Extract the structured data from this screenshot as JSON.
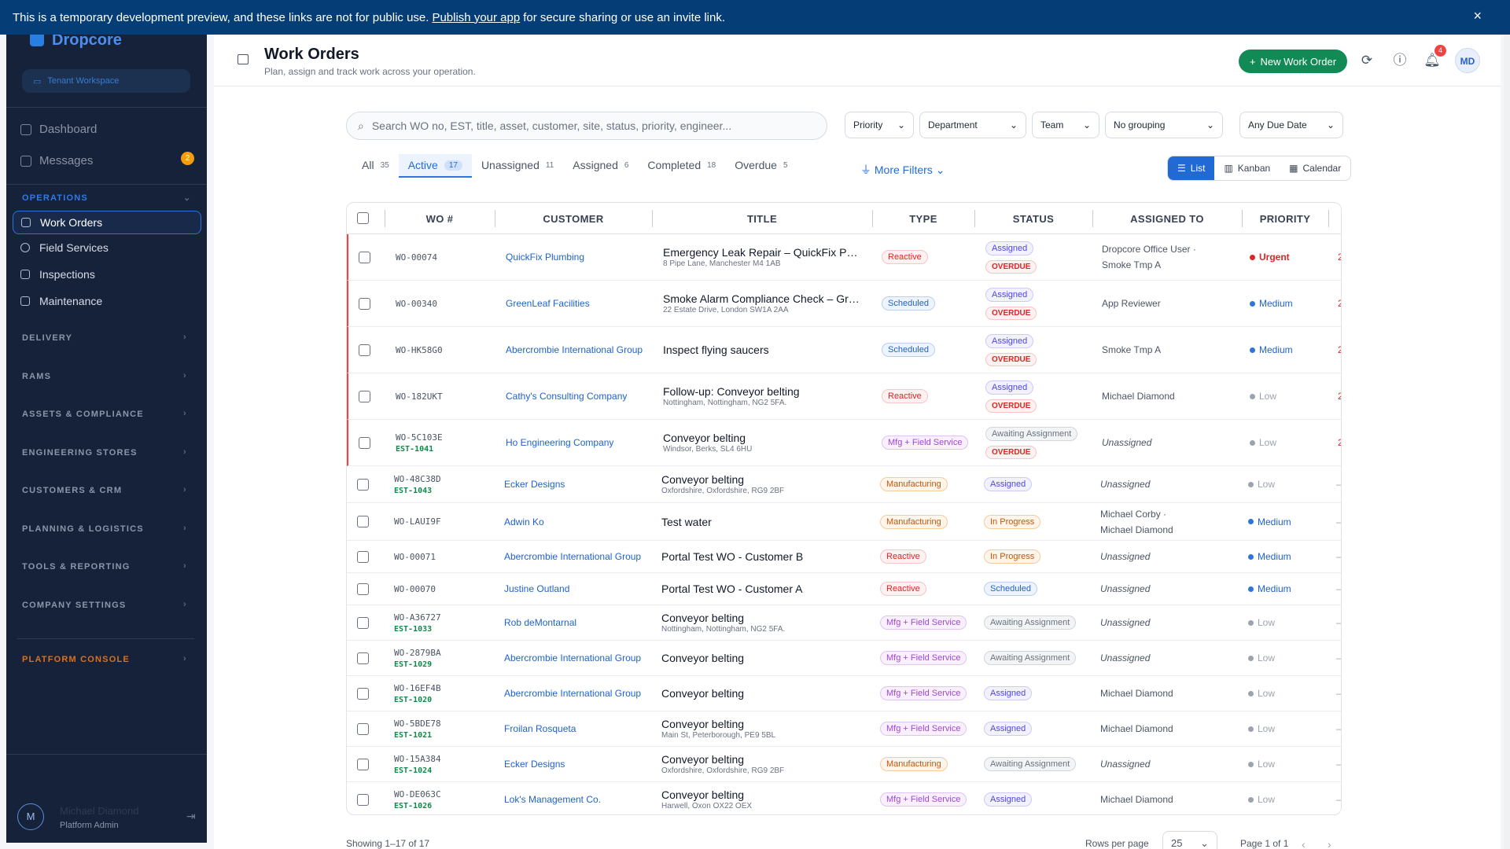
{
  "banner": {
    "text_before": "This is a temporary development preview, and these links are not for public use.",
    "link": "Publish your app",
    "text_after": "for secure sharing or use an invite link.",
    "close": "×"
  },
  "sidebar": {
    "brand": "Dropcore",
    "tenant": "Tenant Workspace",
    "top_items": [
      {
        "label": "Dashboard"
      },
      {
        "label": "Messages",
        "badge": "2"
      }
    ],
    "operations_label": "OPERATIONS",
    "operations_items": [
      {
        "label": "Work Orders"
      },
      {
        "label": "Field Services"
      },
      {
        "label": "Inspections"
      },
      {
        "label": "Maintenance"
      }
    ],
    "sections": [
      "DELIVERY",
      "RAMS",
      "ASSETS & COMPLIANCE",
      "ENGINEERING STORES",
      "CUSTOMERS & CRM",
      "PLANNING & LOGISTICS",
      "TOOLS & REPORTING",
      "COMPANY SETTINGS"
    ],
    "platform": "PLATFORM CONSOLE",
    "user": {
      "initial": "M",
      "name": "Michael Diamond",
      "role": "Platform Admin"
    }
  },
  "header": {
    "title": "Work Orders",
    "subtitle": "Plan, assign and track work across your operation.",
    "new_button": "New Work Order",
    "notif_count": "4",
    "avatar": "MD"
  },
  "search": {
    "placeholder": "Search WO no, EST, title, asset, customer, site, status, priority, engineer..."
  },
  "filters": {
    "priority": "Priority",
    "department": "Department",
    "team": "Team",
    "grouping": "No grouping",
    "due": "Any Due Date"
  },
  "tabs": [
    {
      "label": "All",
      "count": "35"
    },
    {
      "label": "Active",
      "count": "17"
    },
    {
      "label": "Unassigned",
      "count": "11"
    },
    {
      "label": "Assigned",
      "count": "6"
    },
    {
      "label": "Completed",
      "count": "18"
    },
    {
      "label": "Overdue",
      "count": "5"
    }
  ],
  "more_filters": "More Filters",
  "views": {
    "list": "List",
    "kanban": "Kanban",
    "calendar": "Calendar"
  },
  "columns": {
    "wo": "WO #",
    "customer": "CUSTOMER",
    "title": "TITLE",
    "type": "TYPE",
    "status": "STATUS",
    "assigned": "ASSIGNED TO",
    "priority": "PRIORITY"
  },
  "rows": [
    {
      "wo": "WO-00074",
      "est": "",
      "customer": "QuickFix Plumbing",
      "title": "Emergency Leak Repair – QuickFix Plumbing",
      "addr": "8 Pipe Lane, Manchester M4 1AB",
      "type": "Reactive",
      "status": "Assigned",
      "overdue": "OVERDUE",
      "assigned": "Dropcore Office User ·",
      "assigned2": "Smoke Tmp A",
      "priority": "Urgent",
      "extra": "2"
    },
    {
      "wo": "WO-00340",
      "est": "",
      "customer": "GreenLeaf Facilities",
      "title": "Smoke Alarm Compliance Check – GreenLeaf",
      "addr": "22 Estate Drive, London SW1A 2AA",
      "type": "Scheduled",
      "status": "Assigned",
      "overdue": "OVERDUE",
      "assigned": "App Reviewer",
      "assigned2": "",
      "priority": "Medium",
      "extra": "2"
    },
    {
      "wo": "WO-HK58G0",
      "est": "",
      "customer": "Abercrombie International Group",
      "title": "Inspect flying saucers",
      "addr": "",
      "type": "Scheduled",
      "status": "Assigned",
      "overdue": "OVERDUE",
      "assigned": "Smoke Tmp A",
      "assigned2": "",
      "priority": "Medium",
      "extra": "2"
    },
    {
      "wo": "WO-182UKT",
      "est": "",
      "customer": "Cathy's Consulting Company",
      "title": "Follow-up: Conveyor belting",
      "addr": "Nottingham, Nottingham, NG2 5FA.",
      "type": "Reactive",
      "status": "Assigned",
      "overdue": "OVERDUE",
      "assigned": "Michael Diamond",
      "assigned2": "",
      "priority": "Low",
      "extra": "2"
    },
    {
      "wo": "WO-5C103E",
      "est": "EST-1041",
      "customer": "Ho Engineering Company",
      "title": "Conveyor belting",
      "addr": "Windsor, Berks, SL4 6HU",
      "type": "Mfg + Field Service",
      "status": "Awaiting Assignment",
      "overdue": "OVERDUE",
      "assigned": "Unassigned",
      "assigned2": "",
      "priority": "Low",
      "extra": "2"
    },
    {
      "wo": "WO-48C38D",
      "est": "EST-1043",
      "customer": "Ecker Designs",
      "title": "Conveyor belting",
      "addr": "Oxfordshire, Oxfordshire, RG9 2BF",
      "type": "Manufacturing",
      "status": "Assigned",
      "overdue": "",
      "assigned": "Unassigned",
      "assigned2": "",
      "priority": "Low",
      "extra": "–"
    },
    {
      "wo": "WO-LAUI9F",
      "est": "",
      "customer": "Adwin Ko",
      "title": "Test water",
      "addr": "",
      "type": "Manufacturing",
      "status": "In Progress",
      "overdue": "",
      "assigned": "Michael Corby ·",
      "assigned2": "Michael Diamond",
      "priority": "Medium",
      "extra": "–"
    },
    {
      "wo": "WO-00071",
      "est": "",
      "customer": "Abercrombie International Group",
      "title": "Portal Test WO - Customer B",
      "addr": "",
      "type": "Reactive",
      "status": "In Progress",
      "overdue": "",
      "assigned": "Unassigned",
      "assigned2": "",
      "priority": "Medium",
      "extra": "–"
    },
    {
      "wo": "WO-00070",
      "est": "",
      "customer": "Justine Outland",
      "title": "Portal Test WO - Customer A",
      "addr": "",
      "type": "Reactive",
      "status": "Scheduled",
      "overdue": "",
      "assigned": "Unassigned",
      "assigned2": "",
      "priority": "Medium",
      "extra": "–"
    },
    {
      "wo": "WO-A36727",
      "est": "EST-1033",
      "customer": "Rob deMontarnal",
      "title": "Conveyor belting",
      "addr": "Nottingham, Nottingham, NG2 5FA.",
      "type": "Mfg + Field Service",
      "status": "Awaiting Assignment",
      "overdue": "",
      "assigned": "Unassigned",
      "assigned2": "",
      "priority": "Low",
      "extra": "–"
    },
    {
      "wo": "WO-2879BA",
      "est": "EST-1029",
      "customer": "Abercrombie International Group",
      "title": "Conveyor belting",
      "addr": "",
      "type": "Mfg + Field Service",
      "status": "Awaiting Assignment",
      "overdue": "",
      "assigned": "Unassigned",
      "assigned2": "",
      "priority": "Low",
      "extra": "–"
    },
    {
      "wo": "WO-16EF4B",
      "est": "EST-1020",
      "customer": "Abercrombie International Group",
      "title": "Conveyor belting",
      "addr": "",
      "type": "Mfg + Field Service",
      "status": "Assigned",
      "overdue": "",
      "assigned": "Michael Diamond",
      "assigned2": "",
      "priority": "Low",
      "extra": "–"
    },
    {
      "wo": "WO-5BDE78",
      "est": "EST-1021",
      "customer": "Froilan Rosqueta",
      "title": "Conveyor belting",
      "addr": "Main St, Peterborough, PE9 5BL",
      "type": "Mfg + Field Service",
      "status": "Assigned",
      "overdue": "",
      "assigned": "Michael Diamond",
      "assigned2": "",
      "priority": "Low",
      "extra": "–"
    },
    {
      "wo": "WO-15A384",
      "est": "EST-1024",
      "customer": "Ecker Designs",
      "title": "Conveyor belting",
      "addr": "Oxfordshire, Oxfordshire, RG9 2BF",
      "type": "Manufacturing",
      "status": "Awaiting Assignment",
      "overdue": "",
      "assigned": "Unassigned",
      "assigned2": "",
      "priority": "Low",
      "extra": "–"
    },
    {
      "wo": "WO-DE063C",
      "est": "EST-1026",
      "customer": "Lok's Management Co.",
      "title": "Conveyor belting",
      "addr": "Harwell, Oxon OX22 OEX",
      "type": "Mfg + Field Service",
      "status": "Assigned",
      "overdue": "",
      "assigned": "Michael Diamond",
      "assigned2": "",
      "priority": "Low",
      "extra": "–"
    }
  ],
  "footer": {
    "showing": "Showing 1–17 of 17",
    "rows_per_page_label": "Rows per page",
    "rows_per_page": "25",
    "page": "Page 1 of 1"
  }
}
